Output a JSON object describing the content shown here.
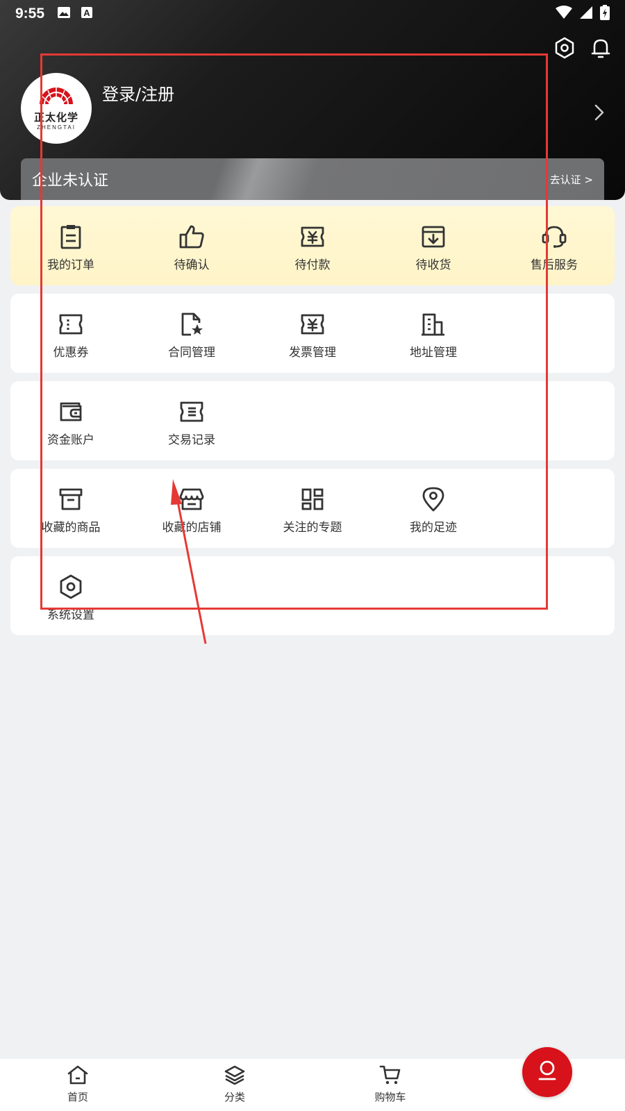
{
  "status_bar": {
    "time": "9:55",
    "left_icons": [
      "image-icon",
      "a-icon"
    ],
    "right_icons": [
      "wifi-icon",
      "signal-icon",
      "battery-icon"
    ]
  },
  "header": {
    "settings_icon": "settings-hex-icon",
    "bell_icon": "bell-icon",
    "logo_cn": "正太化学",
    "logo_en": "ZHENGTAI",
    "login_text": "登录/注册",
    "cert_label": "企业未认证",
    "cert_link": "去认证 >"
  },
  "orders": [
    {
      "label": "我的订单",
      "icon": "clipboard-icon"
    },
    {
      "label": "待确认",
      "icon": "thumbs-up-icon"
    },
    {
      "label": "待付款",
      "icon": "yuan-ticket-icon"
    },
    {
      "label": "待收货",
      "icon": "inbox-download-icon"
    },
    {
      "label": "售后服务",
      "icon": "headset-icon"
    }
  ],
  "tools": [
    {
      "label": "优惠券",
      "icon": "coupon-icon"
    },
    {
      "label": "合同管理",
      "icon": "contract-star-icon"
    },
    {
      "label": "发票管理",
      "icon": "invoice-icon"
    },
    {
      "label": "地址管理",
      "icon": "building-icon"
    }
  ],
  "finance": [
    {
      "label": "资金账户",
      "icon": "wallet-icon"
    },
    {
      "label": "交易记录",
      "icon": "record-ticket-icon"
    }
  ],
  "favorites": [
    {
      "label": "收藏的商品",
      "icon": "archive-box-icon"
    },
    {
      "label": "收藏的店铺",
      "icon": "store-icon"
    },
    {
      "label": "关注的专题",
      "icon": "grid-apps-icon"
    },
    {
      "label": "我的足迹",
      "icon": "location-pin-icon"
    }
  ],
  "system": [
    {
      "label": "系统设置",
      "icon": "settings-hex-icon"
    }
  ],
  "bottom_nav": [
    {
      "label": "首页",
      "icon": "home-icon"
    },
    {
      "label": "分类",
      "icon": "layers-icon"
    },
    {
      "label": "购物车",
      "icon": "cart-icon"
    }
  ],
  "fab_icon": "profile-icon",
  "colors": {
    "accent_red": "#d7121b",
    "annotation_red": "#e53935",
    "order_card_bg": "#fff6ce"
  }
}
